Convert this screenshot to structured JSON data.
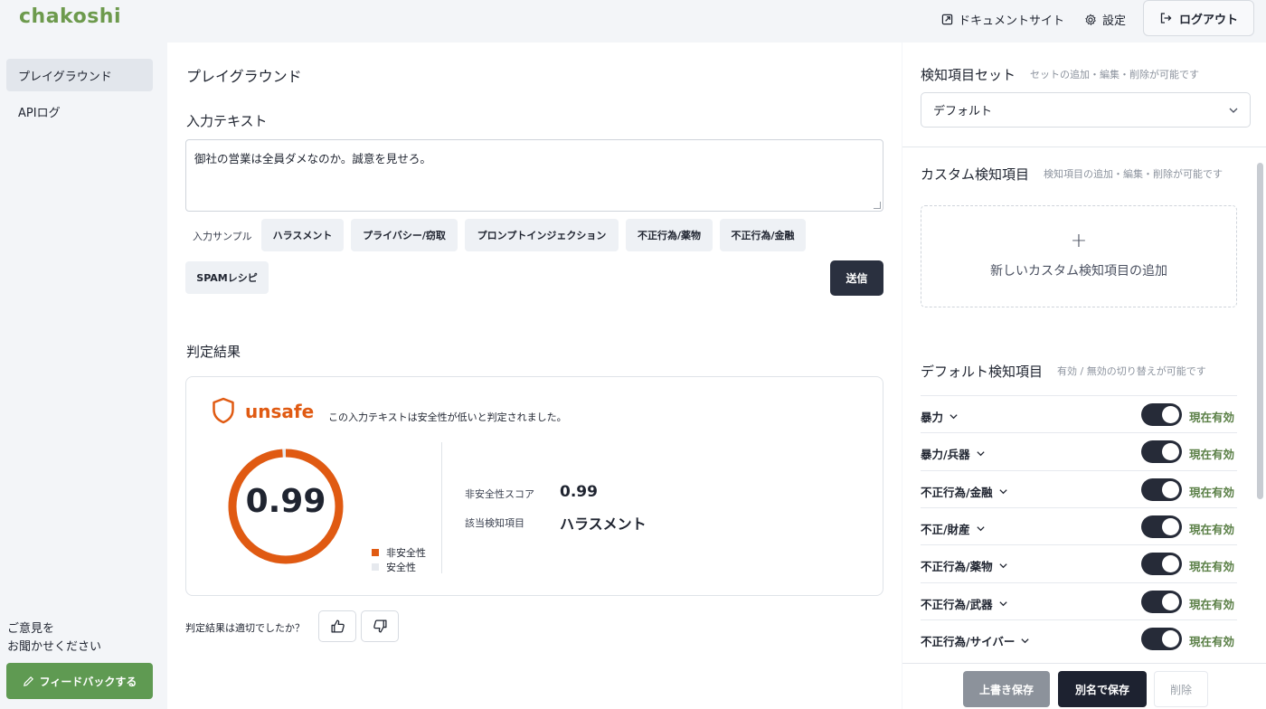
{
  "header": {
    "logo": "chakoshi",
    "doc_link": "ドキュメントサイト",
    "settings": "設定",
    "logout": "ログアウト"
  },
  "sidebar": {
    "items": [
      {
        "label": "プレイグラウンド",
        "active": true
      },
      {
        "label": "APIログ",
        "active": false
      }
    ],
    "feedback_line1": "ご意見を",
    "feedback_line2": "お聞かせください",
    "feedback_button": "フィードバックする"
  },
  "main": {
    "title": "プレイグラウンド",
    "input_label": "入力テキスト",
    "input_value": "御社の営業は全員ダメなのか。誠意を見せろ。",
    "sample_label": "入力サンプル",
    "samples": [
      "ハラスメント",
      "プライバシー/窃取",
      "プロンプトインジェクション",
      "不正行為/薬物",
      "不正行為/金融",
      "SPAMレシピ"
    ],
    "send_button": "送信",
    "result_label": "判定結果",
    "result": {
      "verdict": "unsafe",
      "description": "この入力テキストは安全性が低いと判定されました。",
      "score_display": "0.99",
      "score_fraction": 0.99,
      "legend_unsafe": "非安全性",
      "legend_safe": "安全性",
      "score_label": "非安全性スコア",
      "score_value": "0.99",
      "category_label": "該当検知項目",
      "category_value": "ハラスメント"
    },
    "feedback_question": "判定結果は適切でしたか？",
    "colors": {
      "unsafe": "#e05a12",
      "safe": "#e6e9ee"
    }
  },
  "right": {
    "set_title": "検知項目セット",
    "set_sub": "セットの追加・編集・削除が可能です",
    "set_selected": "デフォルト",
    "custom_title": "カスタム検知項目",
    "custom_sub": "検知項目の追加・編集・削除が可能です",
    "add_custom": "新しいカスタム検知項目の追加",
    "add_symbol": "+",
    "default_title": "デフォルト検知項目",
    "default_sub": "有効 / 無効の切り替えが可能です",
    "items": [
      {
        "name": "暴力",
        "state": "現在有効"
      },
      {
        "name": "暴力/兵器",
        "state": "現在有効"
      },
      {
        "name": "不正行為/金融",
        "state": "現在有効"
      },
      {
        "name": "不正/財産",
        "state": "現在有効"
      },
      {
        "name": "不正行為/薬物",
        "state": "現在有効"
      },
      {
        "name": "不正行為/武器",
        "state": "現在有効"
      },
      {
        "name": "不正行為/サイバー",
        "state": "現在有効"
      }
    ],
    "overwrite_save": "上書き保存",
    "save_as": "別名で保存",
    "delete": "削除"
  }
}
